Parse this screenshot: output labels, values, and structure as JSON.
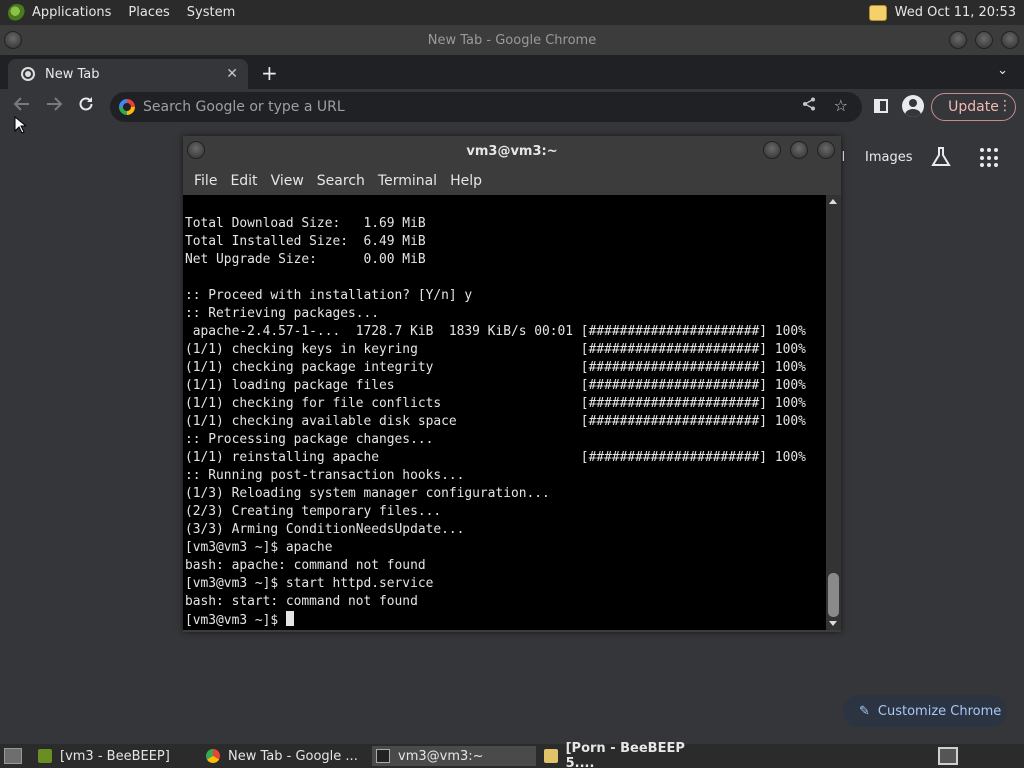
{
  "top_panel": {
    "menus": [
      "Applications",
      "Places",
      "System"
    ],
    "clock": "Wed Oct 11, 20:53"
  },
  "chrome": {
    "window_title": "New Tab - Google Chrome",
    "tab_title": "New Tab",
    "tab_close": "✕",
    "new_tab": "+",
    "tab_menu": "⌄",
    "omnibox_placeholder": "Search Google or type a URL",
    "update_label": "Update",
    "update_menu": "⋮",
    "ntp_gmail": "il",
    "ntp_images": "Images",
    "customize_label": "Customize Chrome"
  },
  "terminal": {
    "title": "vm3@vm3:~",
    "menus": [
      "File",
      "Edit",
      "View",
      "Search",
      "Terminal",
      "Help"
    ],
    "lines": [
      "Total Download Size:   1.69 MiB",
      "Total Installed Size:  6.49 MiB",
      "Net Upgrade Size:      0.00 MiB",
      "",
      ":: Proceed with installation? [Y/n] y",
      ":: Retrieving packages...",
      " apache-2.4.57-1-...  1728.7 KiB  1839 KiB/s 00:01 [######################] 100%",
      "(1/1) checking keys in keyring                     [######################] 100%",
      "(1/1) checking package integrity                   [######################] 100%",
      "(1/1) loading package files                        [######################] 100%",
      "(1/1) checking for file conflicts                  [######################] 100%",
      "(1/1) checking available disk space                [######################] 100%",
      ":: Processing package changes...",
      "(1/1) reinstalling apache                          [######################] 100%",
      ":: Running post-transaction hooks...",
      "(1/3) Reloading system manager configuration...",
      "(2/3) Creating temporary files...",
      "(3/3) Arming ConditionNeedsUpdate...",
      "[vm3@vm3 ~]$ apache",
      "bash: apache: command not found",
      "[vm3@vm3 ~]$ start httpd.service",
      "bash: start: command not found"
    ],
    "prompt": "[vm3@vm3 ~]$ "
  },
  "taskbar": {
    "tasks": [
      "[vm3 - BeeBEEP]",
      "New Tab - Google ...",
      "vm3@vm3:~",
      "[Porn - BeeBEEP 5...."
    ]
  },
  "colors": {
    "accent_update": "#f2b8b5",
    "customize_text": "#a8c7fa"
  }
}
